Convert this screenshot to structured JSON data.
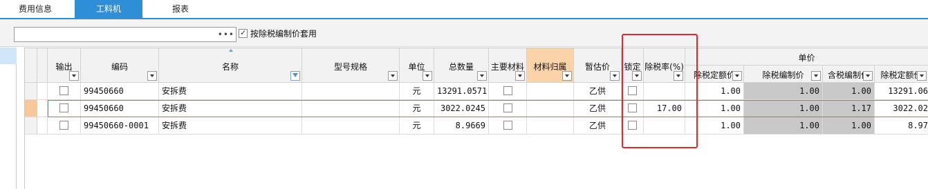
{
  "tabs": [
    {
      "label": "费用信息",
      "active": false
    },
    {
      "label": "工料机",
      "active": true
    },
    {
      "label": "报表",
      "active": false
    }
  ],
  "toolbar": {
    "search_value": "",
    "more_label": "•••",
    "option_label": "按除税编制价套用",
    "option_checked": true
  },
  "columns": {
    "output": "输出",
    "code": "编码",
    "name": "名称",
    "model": "型号规格",
    "unit": "单位",
    "total_qty": "总数量",
    "main_material": "主要材料",
    "material_owner": "材料归属",
    "estimate": "暂估价",
    "lock": "锁定",
    "tax_rate": "除税率(%)",
    "unit_price_group": "单价",
    "price_tax_excl_quota": "除税定额价",
    "price_tax_excl_compiled": "除税编制价",
    "price_tax_incl_compiled": "含税编制价",
    "price_tax_excl_quota2": "除税定额价"
  },
  "rows": [
    {
      "output": false,
      "code": "99450660",
      "name": "安拆费",
      "model": "",
      "unit": "元",
      "total_qty": "13291.0571",
      "main_material": false,
      "material_owner": "",
      "estimate": "乙供",
      "lock": false,
      "tax_rate": "",
      "p1": "1.00",
      "p2": "1.00",
      "p3": "1.00",
      "p4": "13291.06"
    },
    {
      "output": false,
      "code": "99450660",
      "name": "安拆费",
      "model": "",
      "unit": "元",
      "total_qty": "3022.0245",
      "main_material": false,
      "material_owner": "",
      "estimate": "乙供",
      "lock": false,
      "tax_rate": "17.00",
      "p1": "1.00",
      "p2": "1.00",
      "p3": "1.17",
      "p4": "3022.02"
    },
    {
      "output": false,
      "code": "99450660-0001",
      "name": "安拆费",
      "model": "",
      "unit": "元",
      "total_qty": "8.9669",
      "main_material": false,
      "material_owner": "",
      "estimate": "乙供",
      "lock": false,
      "tax_rate": "",
      "p1": "1.00",
      "p2": "1.00",
      "p3": "1.00",
      "p4": "8.97"
    }
  ],
  "colors": {
    "accent": "#2e8fd6",
    "highlight_box": "#e8262a",
    "row_selection": "#3caa6a",
    "orange_header": "#fbd3a8"
  }
}
